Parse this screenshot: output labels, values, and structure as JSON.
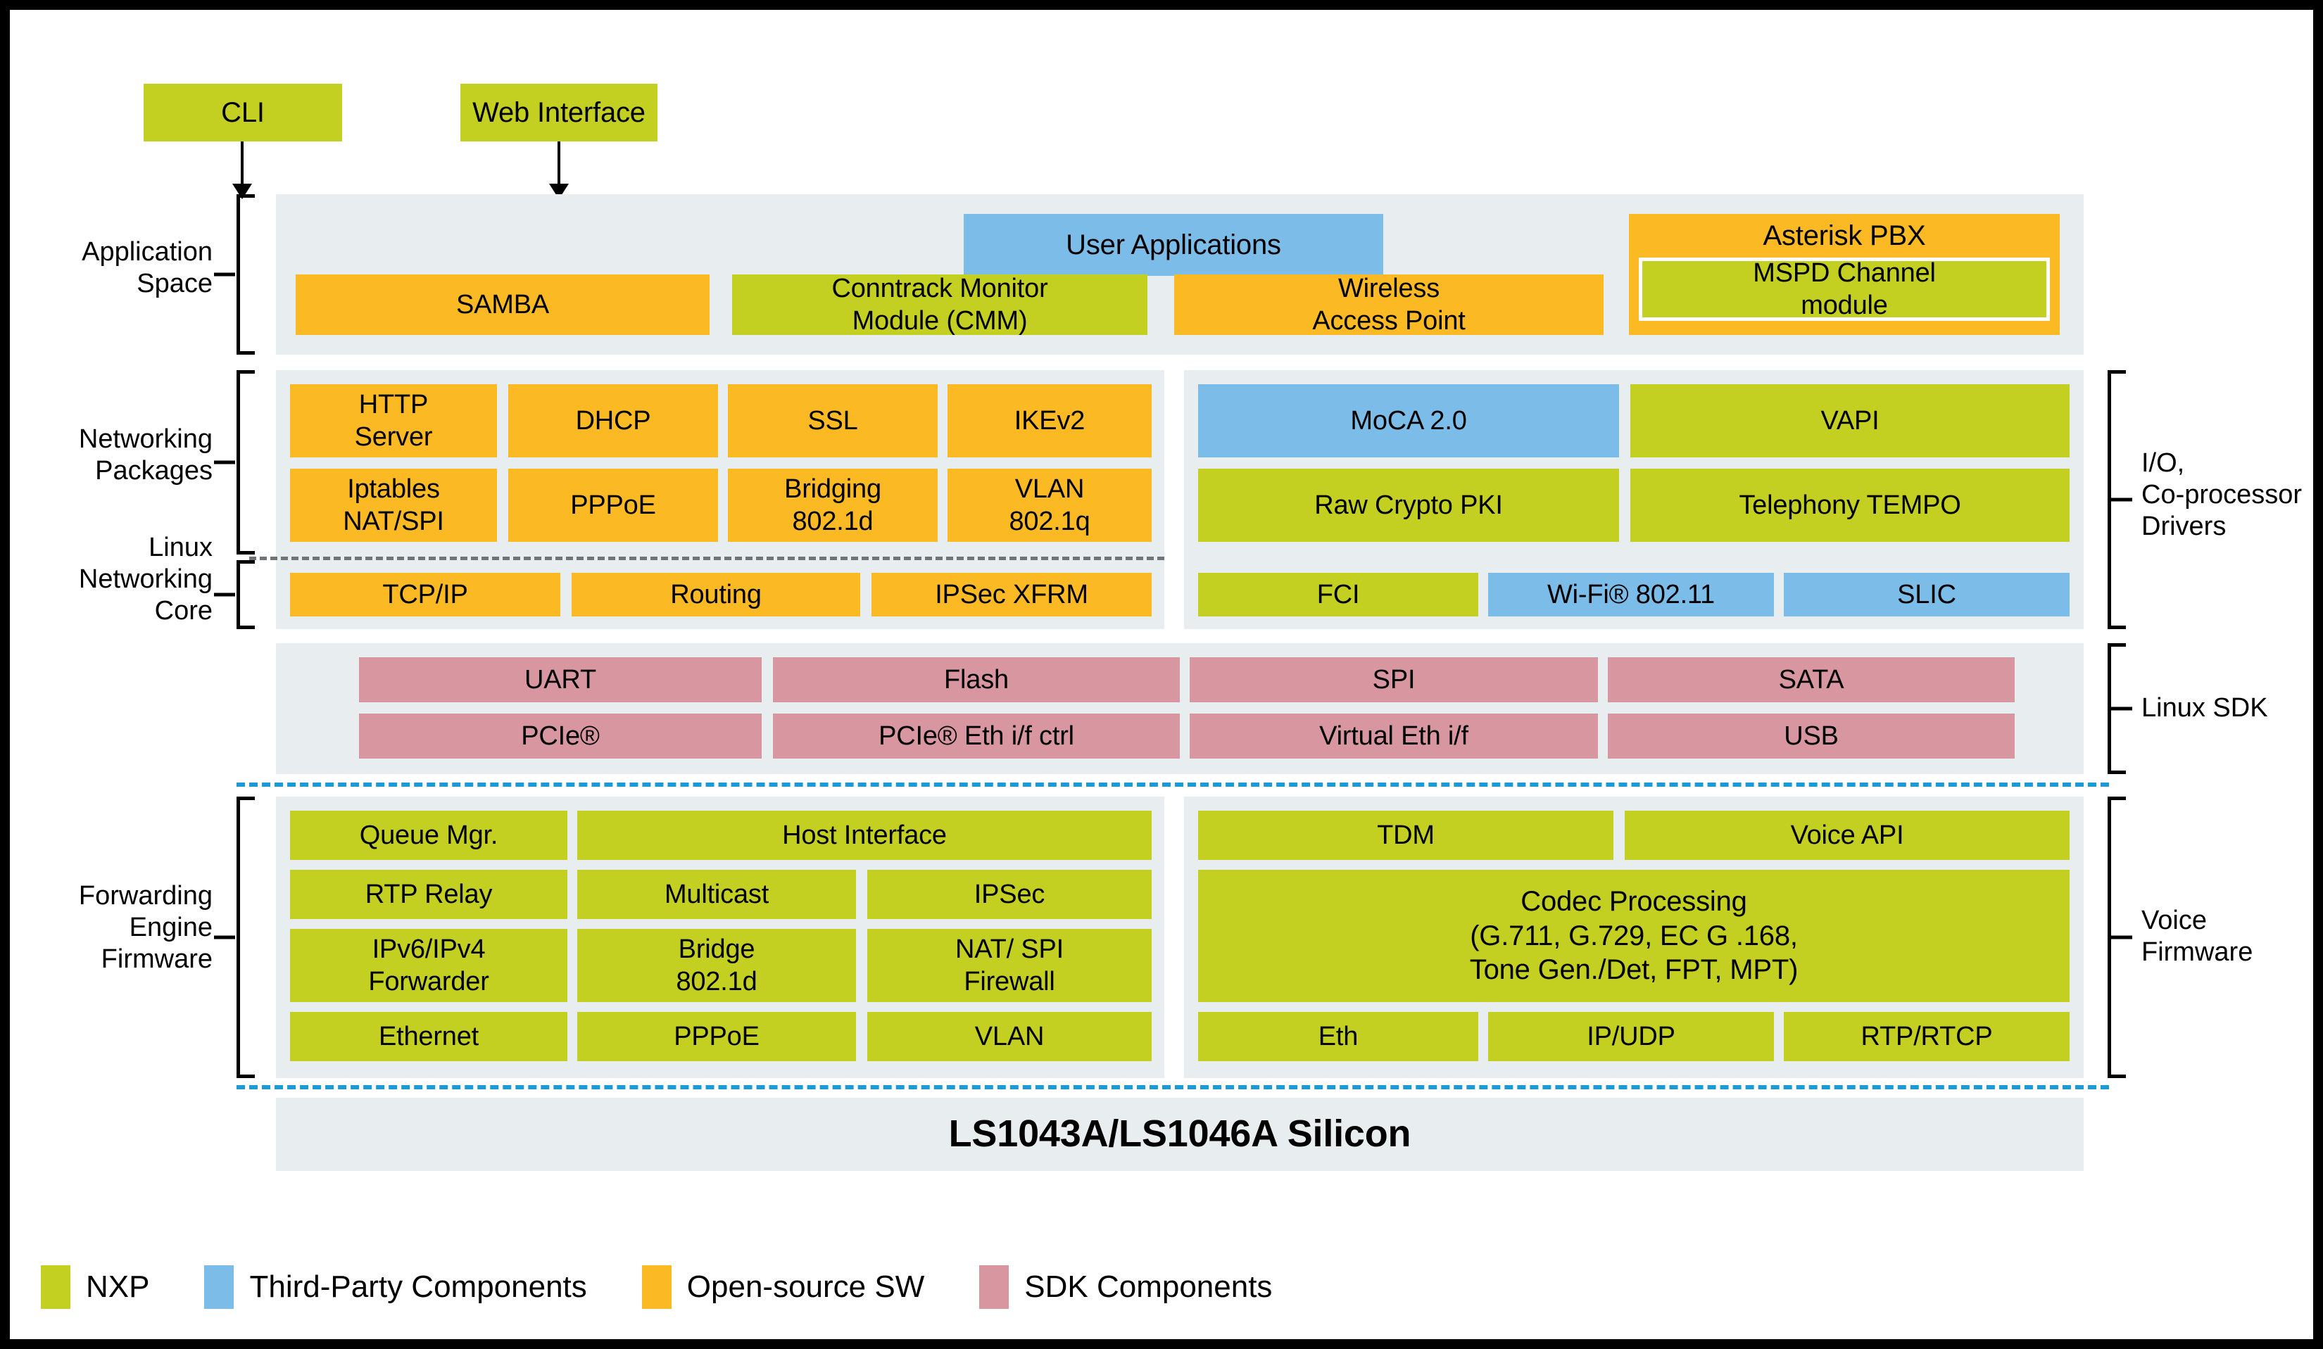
{
  "legend": {
    "items": [
      {
        "label": "NXP",
        "color": "#C3D021",
        "key": "nxp"
      },
      {
        "label": "Third-Party Components",
        "color": "#7CBCE8",
        "key": "third"
      },
      {
        "label": "Open-source SW",
        "color": "#FBB924",
        "key": "third_party"
      },
      {
        "label": "SDK Components",
        "color": "#D896A1",
        "key": "sdk"
      }
    ]
  },
  "launchers": [
    {
      "label": "CLI",
      "color": "#C3D021"
    },
    {
      "label": "Web Interface",
      "color": "#C3D021"
    }
  ],
  "left_labels": [
    {
      "label": "Application\nSpace"
    },
    {
      "label": "Networking\nPackages"
    },
    {
      "label": "Linux\nNetworking\nCore"
    },
    {
      "label": "Forwarding\nEngine\nFirmware"
    }
  ],
  "right_labels": [
    {
      "label": "I/O,\nCo-processor\nDrivers"
    },
    {
      "label": "Linux SDK"
    },
    {
      "label": "Voice\nFirmware"
    }
  ],
  "application_space": {
    "top_row": [
      {
        "label": "User Applications",
        "color": "third"
      },
      {
        "label": "Asterisk PBX",
        "color": "open"
      }
    ],
    "bottom_row": [
      {
        "label": "SAMBA",
        "color": "open"
      },
      {
        "label": "Conntrack Monitor\nModule (CMM)",
        "color": "nxp"
      },
      {
        "label": "Wireless\nAccess Point",
        "color": "open"
      }
    ],
    "nested": {
      "label": "MSPD Channel\nmodule",
      "color": "nxp"
    }
  },
  "networking_left": {
    "row1": [
      {
        "label": "HTTP\nServer",
        "color": "open"
      },
      {
        "label": "DHCP",
        "color": "open"
      },
      {
        "label": "SSL",
        "color": "open"
      },
      {
        "label": "IKEv2",
        "color": "open"
      }
    ],
    "row2": [
      {
        "label": "Iptables\nNAT/SPI",
        "color": "open"
      },
      {
        "label": "PPPoE",
        "color": "open"
      },
      {
        "label": "Bridging\n802.1d",
        "color": "open"
      },
      {
        "label": "VLAN\n802.1q",
        "color": "open"
      }
    ],
    "row3": [
      {
        "label": "TCP/IP",
        "color": "open"
      },
      {
        "label": "Routing",
        "color": "open"
      },
      {
        "label": "IPSec XFRM",
        "color": "open"
      }
    ]
  },
  "networking_right": {
    "row1": [
      {
        "label": "MoCA 2.0",
        "color": "third"
      },
      {
        "label": "VAPI",
        "color": "nxp"
      }
    ],
    "row2": [
      {
        "label": "Raw Crypto PKI",
        "color": "nxp"
      },
      {
        "label": "Telephony TEMPO",
        "color": "nxp"
      }
    ],
    "row3": [
      {
        "label": "FCI",
        "color": "nxp"
      },
      {
        "label": "Wi-Fi® 802.11",
        "color": "third"
      },
      {
        "label": "SLIC",
        "color": "third"
      }
    ]
  },
  "sdk_layer": {
    "row1": [
      {
        "label": "UART",
        "color": "sdk"
      },
      {
        "label": "Flash",
        "color": "sdk"
      },
      {
        "label": "SPI",
        "color": "sdk"
      },
      {
        "label": "SATA",
        "color": "sdk"
      }
    ],
    "row2": [
      {
        "label": "PCIe®",
        "color": "sdk"
      },
      {
        "label": "PCIe® Eth i/f ctrl",
        "color": "sdk"
      },
      {
        "label": "Virtual Eth i/f",
        "color": "sdk"
      },
      {
        "label": "USB",
        "color": "sdk"
      }
    ]
  },
  "forwarding_engine": {
    "row1": [
      {
        "label": "Queue Mgr.",
        "color": "nxp"
      },
      {
        "label": "Host Interface",
        "color": "nxp"
      }
    ],
    "row2": [
      {
        "label": "RTP Relay",
        "color": "nxp"
      },
      {
        "label": "Multicast",
        "color": "nxp"
      },
      {
        "label": "IPSec",
        "color": "nxp"
      }
    ],
    "row3": [
      {
        "label": "IPv6/IPv4\nForwarder",
        "color": "nxp"
      },
      {
        "label": "Bridge\n802.1d",
        "color": "nxp"
      },
      {
        "label": "NAT/ SPI\nFirewall",
        "color": "nxp"
      }
    ],
    "row4": [
      {
        "label": "Ethernet",
        "color": "nxp"
      },
      {
        "label": "PPPoE",
        "color": "nxp"
      },
      {
        "label": "VLAN",
        "color": "nxp"
      }
    ]
  },
  "voice_firmware": {
    "row1": [
      {
        "label": "TDM",
        "color": "nxp"
      },
      {
        "label": "Voice API",
        "color": "nxp"
      }
    ],
    "row2": [
      {
        "label": "Codec Processing\n(G.711, G.729, EC G .168,\nTone Gen./Det, FPT, MPT)",
        "color": "nxp"
      }
    ],
    "row3": [
      {
        "label": "Eth",
        "color": "nxp"
      },
      {
        "label": "IP/UDP",
        "color": "nxp"
      },
      {
        "label": "RTP/RTCP",
        "color": "nxp"
      }
    ]
  },
  "silicon": {
    "label": "LS1043A/LS1046A Silicon"
  },
  "colors": {
    "nxp": "#C3D021",
    "third_party": "#7CBCE8",
    "open_source": "#FBB924",
    "sdk": "#D896A1",
    "panel": "#E8EDEF",
    "divider_blue": "#1C9AD6",
    "divider_gray": "#6E7478"
  }
}
